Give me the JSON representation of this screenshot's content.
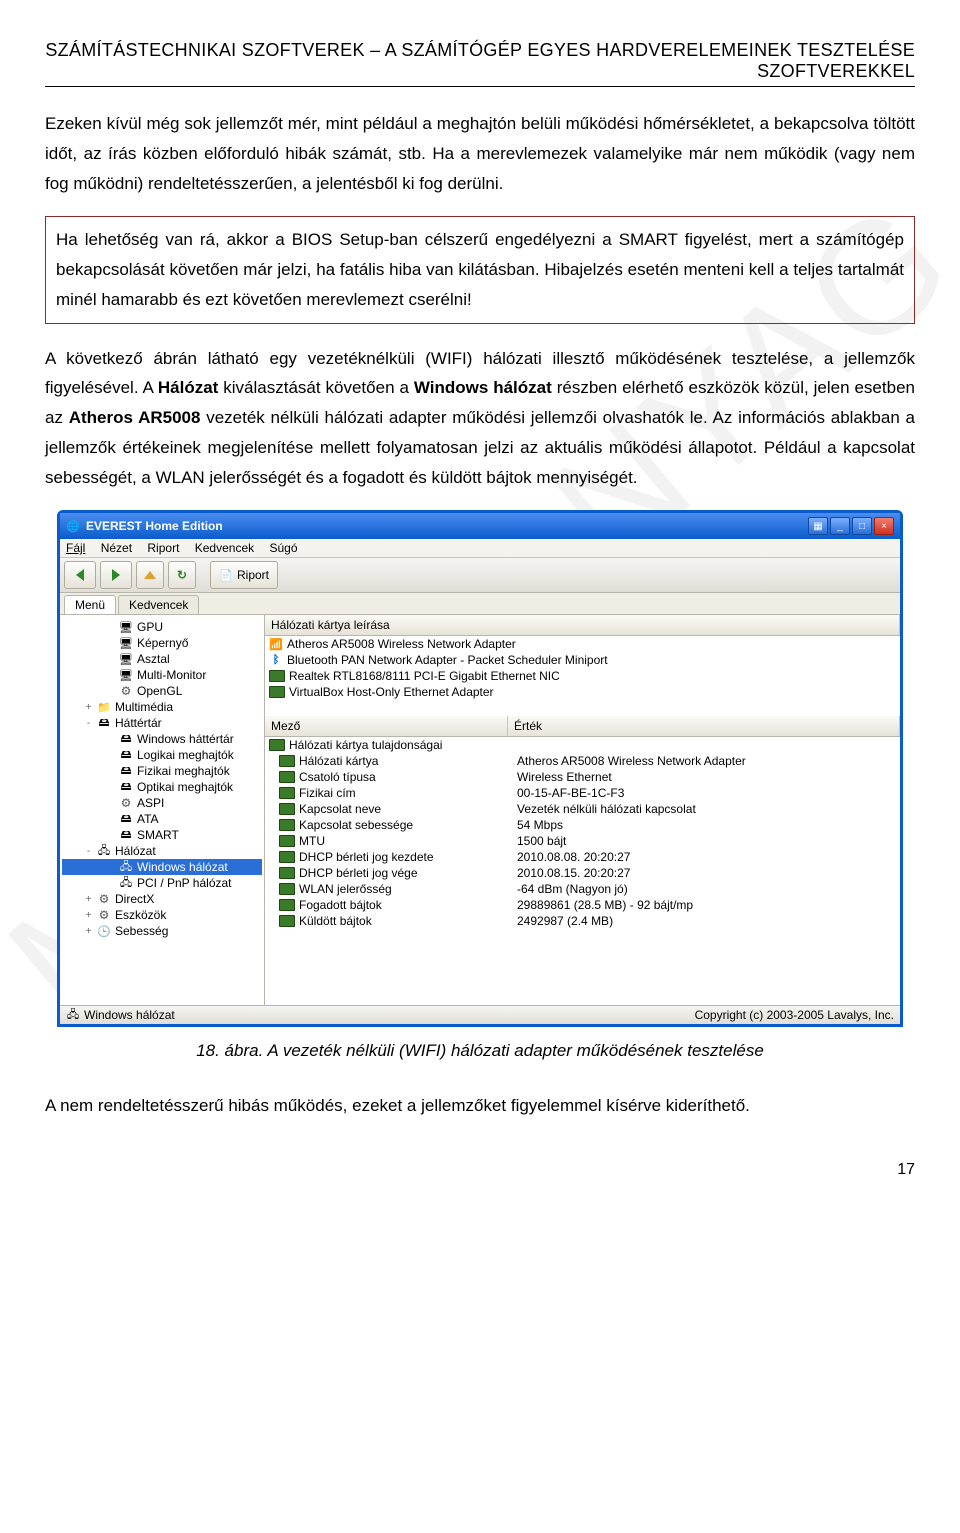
{
  "header": {
    "line1": "SZÁMÍTÁSTECHNIKAI SZOFTVEREK – A SZÁMÍTÓGÉP EGYES HARDVERELEMEINEK TESZTELÉSE",
    "line2": "SZOFTVEREKKEL"
  },
  "para1": "Ezeken kívül még sok jellemzőt mér, mint például a meghajtón belüli működési hőmérsékletet, a bekapcsolva töltött időt, az írás közben előforduló hibák számát, stb. Ha a merevlemezek valamelyike már nem működik (vagy nem fog működni) rendeltetésszerűen, a jelentésből ki fog derülni.",
  "boxtext": "Ha lehetőség van rá, akkor a BIOS Setup-ban célszerű engedélyezni a SMART figyelést, mert a számítógép bekapcsolását követően már jelzi, ha fatális hiba van kilátásban. Hibajelzés esetén menteni kell a teljes tartalmát minél hamarabb és ezt követően merevlemezt cserélni!",
  "para2_a": "A következő ábrán látható egy vezetéknélküli (WIFI) hálózati illesztő működésének tesztelése, a jellemzők figyelésével. A ",
  "para2_b": "Hálózat",
  "para2_c": " kiválasztását követően a ",
  "para2_d": "Windows hálózat",
  "para2_e": " részben elérhető eszközök közül, jelen esetben az ",
  "para2_f": "Atheros AR5008",
  "para2_g": " vezeték nélküli hálózati adapter működési jellemzői olvashatók le. Az információs ablakban a jellemzők értékeinek megjelenítése mellett folyamatosan jelzi az aktuális működési állapotot. Például a kapcsolat sebességét, a WLAN jelerősségét és a fogadott és küldött bájtok mennyiségét.",
  "caption": "18. ábra. A vezeték nélküli (WIFI) hálózati adapter működésének tesztelése",
  "para3": "A nem rendeltetésszerű hibás működés, ezeket a jellemzőket figyelemmel kísérve kideríthető.",
  "pagenum": "17",
  "watermark": "MUNKAANYAG",
  "app": {
    "title": "EVEREST Home Edition",
    "menus": [
      "Fájl",
      "Nézet",
      "Riport",
      "Kedvencek",
      "Súgó"
    ],
    "toolbar_report": "Riport",
    "tabs": [
      "Menü",
      "Kedvencek"
    ],
    "tree": [
      {
        "lvl": 2,
        "icon": "ic-mon",
        "label": "GPU"
      },
      {
        "lvl": 2,
        "icon": "ic-mon",
        "label": "Képernyő"
      },
      {
        "lvl": 2,
        "icon": "ic-mon",
        "label": "Asztal"
      },
      {
        "lvl": 2,
        "icon": "ic-mon",
        "label": "Multi-Monitor"
      },
      {
        "lvl": 2,
        "icon": "ic-gear",
        "label": "OpenGL"
      },
      {
        "lvl": 1,
        "exp": "+",
        "icon": "ic-fold",
        "label": "Multimédia"
      },
      {
        "lvl": 1,
        "exp": "-",
        "icon": "ic-disk",
        "label": "Háttértár"
      },
      {
        "lvl": 2,
        "icon": "ic-disk",
        "label": "Windows háttértár"
      },
      {
        "lvl": 2,
        "icon": "ic-disk",
        "label": "Logikai meghajtók"
      },
      {
        "lvl": 2,
        "icon": "ic-disk",
        "label": "Fizikai meghajtók"
      },
      {
        "lvl": 2,
        "icon": "ic-disk",
        "label": "Optikai meghajtók"
      },
      {
        "lvl": 2,
        "icon": "ic-gear",
        "label": "ASPI"
      },
      {
        "lvl": 2,
        "icon": "ic-disk",
        "label": "ATA"
      },
      {
        "lvl": 2,
        "icon": "ic-disk",
        "label": "SMART"
      },
      {
        "lvl": 1,
        "exp": "-",
        "icon": "ic-net",
        "label": "Hálózat"
      },
      {
        "lvl": 2,
        "icon": "ic-net",
        "label": "Windows hálózat",
        "sel": true
      },
      {
        "lvl": 2,
        "icon": "ic-net",
        "label": "PCI / PnP hálózat"
      },
      {
        "lvl": 1,
        "exp": "+",
        "icon": "ic-gear",
        "label": "DirectX"
      },
      {
        "lvl": 1,
        "exp": "+",
        "icon": "ic-gear",
        "label": "Eszközök"
      },
      {
        "lvl": 1,
        "exp": "+",
        "icon": "ic-clock",
        "label": "Sebesség"
      }
    ],
    "list_header": "Hálózati kártya leírása",
    "adapters": [
      {
        "icon": "ic-wifi",
        "label": "Atheros AR5008 Wireless Network Adapter"
      },
      {
        "icon": "ic-bt",
        "label": "Bluetooth PAN Network Adapter - Packet Scheduler Miniport"
      },
      {
        "icon": "ic-nic",
        "label": "Realtek RTL8168/8111 PCI-E Gigabit Ethernet NIC"
      },
      {
        "icon": "ic-nic",
        "label": "VirtualBox Host-Only Ethernet Adapter"
      }
    ],
    "grid_h1": "Mező",
    "grid_h2": "Érték",
    "grid": [
      {
        "k": "Hálózati kártya tulajdonságai",
        "v": "",
        "icon": "ic-nic",
        "head": true
      },
      {
        "k": "Hálózati kártya",
        "v": "Atheros AR5008 Wireless Network Adapter",
        "icon": "ic-nic"
      },
      {
        "k": "Csatoló típusa",
        "v": "Wireless Ethernet",
        "icon": "ic-nic"
      },
      {
        "k": "Fizikai cím",
        "v": "00-15-AF-BE-1C-F3",
        "icon": "ic-nic"
      },
      {
        "k": "Kapcsolat neve",
        "v": "Vezeték nélküli hálózati kapcsolat",
        "icon": "ic-nic"
      },
      {
        "k": "Kapcsolat sebessége",
        "v": "54 Mbps",
        "icon": "ic-nic"
      },
      {
        "k": "MTU",
        "v": "1500 bájt",
        "icon": "ic-nic"
      },
      {
        "k": "DHCP bérleti jog kezdete",
        "v": "2010.08.08. 20:20:27",
        "icon": "ic-nic"
      },
      {
        "k": "DHCP bérleti jog vége",
        "v": "2010.08.15. 20:20:27",
        "icon": "ic-nic"
      },
      {
        "k": "WLAN jelerősség",
        "v": "-64 dBm (Nagyon jó)",
        "icon": "ic-nic"
      },
      {
        "k": "Fogadott bájtok",
        "v": "29889861 (28.5 MB) - 92 bájt/mp",
        "icon": "ic-nic"
      },
      {
        "k": "Küldött bájtok",
        "v": "2492987 (2.4 MB)",
        "icon": "ic-nic"
      }
    ],
    "status_left": "Windows hálózat",
    "status_right": "Copyright (c) 2003-2005 Lavalys, Inc."
  }
}
